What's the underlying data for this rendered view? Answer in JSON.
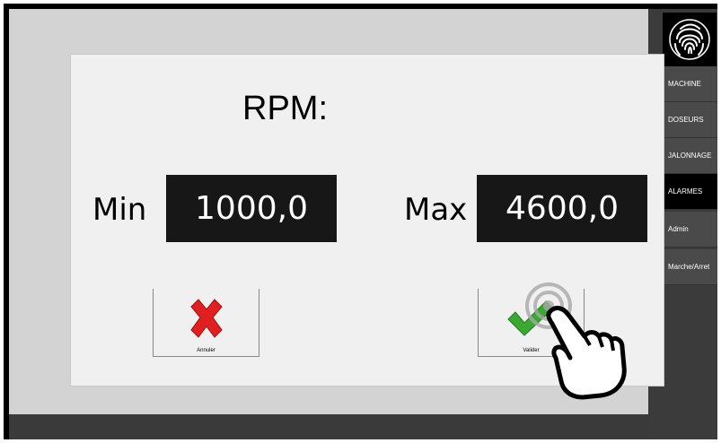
{
  "dialog": {
    "title": "RPM:",
    "min_label": "Min",
    "min_value": "1000,0",
    "max_label": "Max",
    "max_value": "4600,0",
    "cancel_label": "Annuler",
    "confirm_label": "Valider"
  },
  "sidebar": {
    "logo_icon": "fingerprint-icon",
    "items": [
      {
        "label": "MACHINE",
        "active": false
      },
      {
        "label": "DOSEURS",
        "active": false
      },
      {
        "label": "JALONNAGE",
        "active": false
      },
      {
        "label": "ALARMES",
        "active": true
      },
      {
        "label": "Admin",
        "active": false
      },
      {
        "label": "Marche/Arret",
        "active": false
      }
    ]
  },
  "colors": {
    "value_box": "#171717",
    "cancel_icon": "#e02020",
    "confirm_icon": "#3aa832",
    "sidebar": "#3b3b3b"
  }
}
